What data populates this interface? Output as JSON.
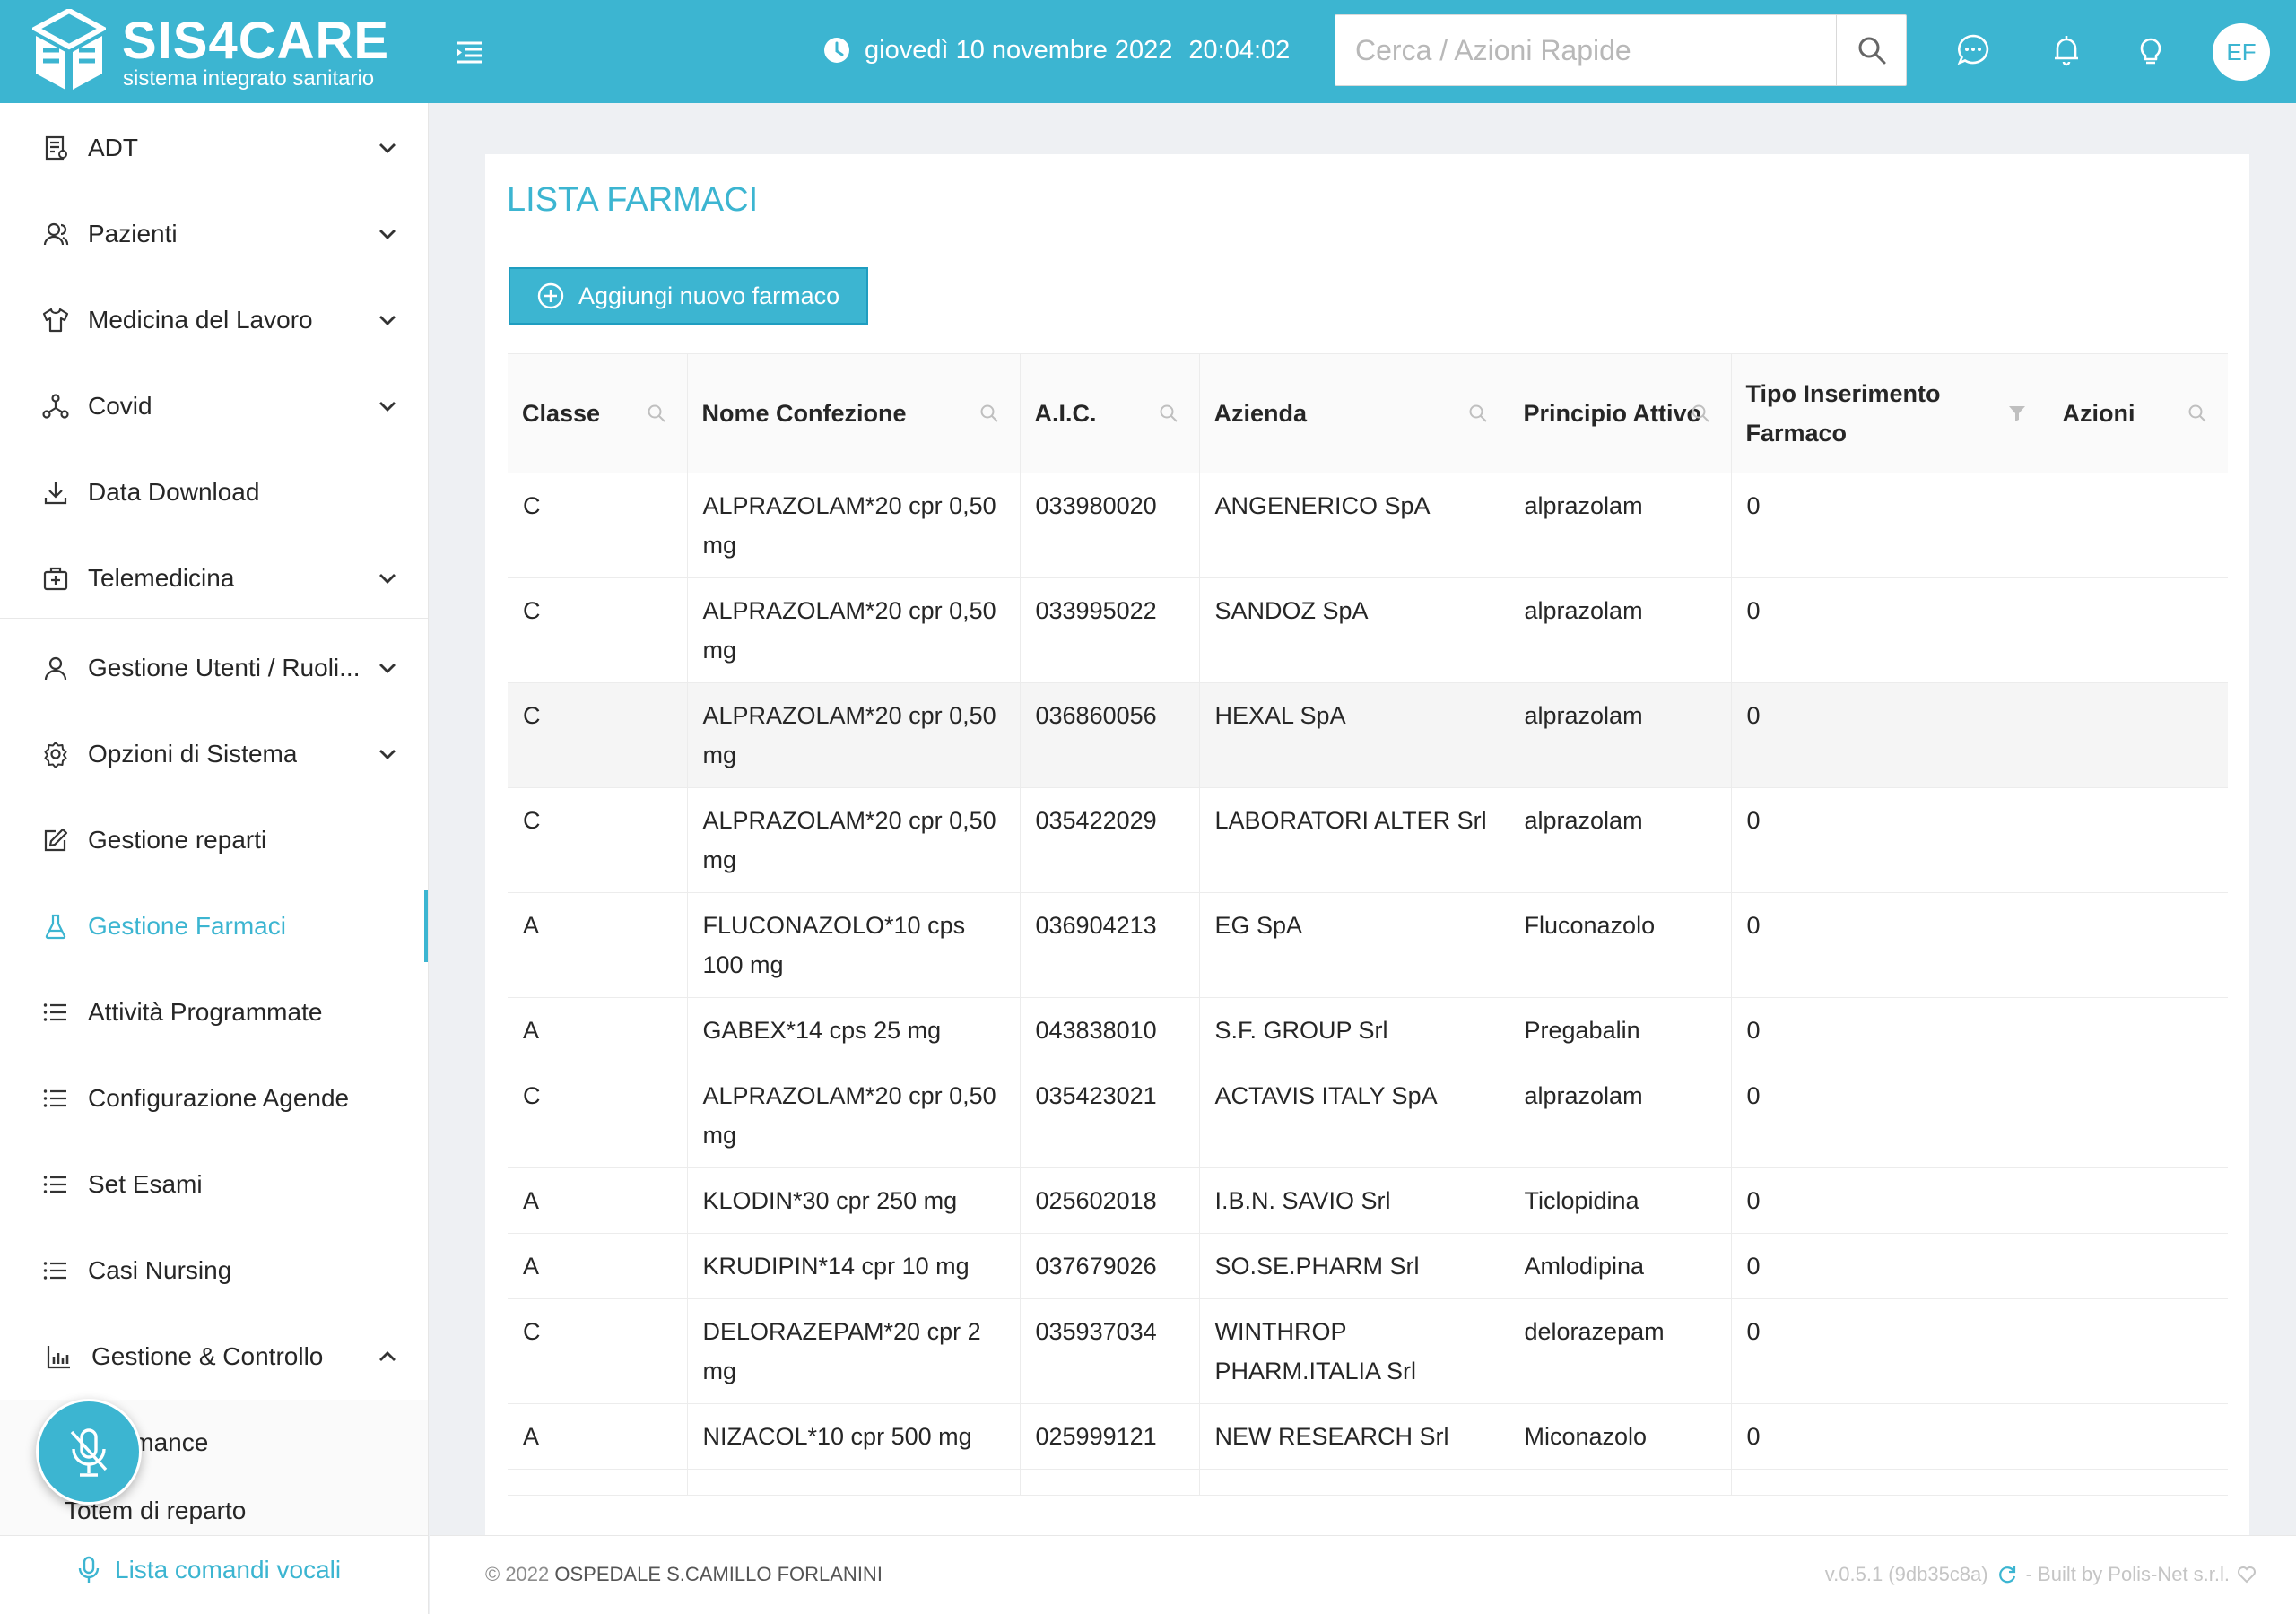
{
  "header": {
    "app_name": "SIS4CARE",
    "app_subtitle": "sistema integrato sanitario",
    "date": "giovedì 10 novembre 2022",
    "time": "20:04:02",
    "search_placeholder": "Cerca / Azioni Rapide",
    "user_initials": "EF",
    "colors": {
      "primary": "#3cb5d1",
      "text": "#ffffff"
    },
    "icons": [
      "menu-fold-icon",
      "clock-icon",
      "search-icon",
      "chat-icon",
      "bell-icon",
      "bulb-icon"
    ]
  },
  "sidebar": {
    "items": [
      {
        "label": "ADT",
        "icon": "adt-icon",
        "expandable": true
      },
      {
        "label": "Pazienti",
        "icon": "patients-icon",
        "expandable": true
      },
      {
        "label": "Medicina del Lavoro",
        "icon": "shirt-icon",
        "expandable": true
      },
      {
        "label": "Covid",
        "icon": "nodes-icon",
        "expandable": true
      },
      {
        "label": "Data Download",
        "icon": "download-icon",
        "expandable": false
      },
      {
        "label": "Telemedicina",
        "icon": "medkit-icon",
        "expandable": true
      },
      {
        "label": "Gestione Utenti / Ruoli...",
        "icon": "user-icon",
        "expandable": true
      },
      {
        "label": "Opzioni di Sistema",
        "icon": "gear-icon",
        "expandable": true
      },
      {
        "label": "Gestione reparti",
        "icon": "edit-icon",
        "expandable": false
      },
      {
        "label": "Gestione Farmaci",
        "icon": "flask-icon",
        "expandable": false,
        "active": true
      },
      {
        "label": "Attività Programmate",
        "icon": "list-icon",
        "expandable": false
      },
      {
        "label": "Configurazione Agende",
        "icon": "list-icon",
        "expandable": false
      },
      {
        "label": "Set Esami",
        "icon": "list-icon",
        "expandable": false
      },
      {
        "label": "Casi Nursing",
        "icon": "list-icon",
        "expandable": false
      },
      {
        "label": "Gestione & Controllo",
        "icon": "bar-chart-icon",
        "expandable": true,
        "expanded": true
      }
    ],
    "subitems": [
      {
        "label": "Performance"
      },
      {
        "label": "Totem di reparto"
      }
    ],
    "voice_commands_label": "Lista comandi vocali"
  },
  "main": {
    "title": "LISTA FARMACI",
    "add_button_label": "Aggiungi nuovo farmaco",
    "table": {
      "columns": [
        {
          "label": "Classe",
          "icon": "search-icon"
        },
        {
          "label": "Nome Confezione",
          "icon": "search-icon"
        },
        {
          "label": "A.I.C.",
          "icon": "search-icon"
        },
        {
          "label": "Azienda",
          "icon": "search-icon"
        },
        {
          "label": "Principio Attivo",
          "icon": "search-icon"
        },
        {
          "label": "Tipo Inserimento Farmaco",
          "icon": "filter-icon"
        },
        {
          "label": "Azioni",
          "icon": "search-icon"
        }
      ],
      "rows": [
        [
          "C",
          "ALPRAZOLAM*20 cpr 0,50 mg",
          "033980020",
          "ANGENERICO SpA",
          "alprazolam",
          "0",
          ""
        ],
        [
          "C",
          "ALPRAZOLAM*20 cpr 0,50 mg",
          "033995022",
          "SANDOZ SpA",
          "alprazolam",
          "0",
          ""
        ],
        [
          "C",
          "ALPRAZOLAM*20 cpr 0,50 mg",
          "036860056",
          "HEXAL SpA",
          "alprazolam",
          "0",
          ""
        ],
        [
          "C",
          "ALPRAZOLAM*20 cpr 0,50 mg",
          "035422029",
          "LABORATORI ALTER Srl",
          "alprazolam",
          "0",
          ""
        ],
        [
          "A",
          "FLUCONAZOLO*10 cps 100 mg",
          "036904213",
          "EG SpA",
          "Fluconazolo",
          "0",
          ""
        ],
        [
          "A",
          "GABEX*14 cps 25 mg",
          "043838010",
          "S.F. GROUP Srl",
          "Pregabalin",
          "0",
          ""
        ],
        [
          "C",
          "ALPRAZOLAM*20 cpr 0,50 mg",
          "035423021",
          "ACTAVIS ITALY SpA",
          "alprazolam",
          "0",
          ""
        ],
        [
          "A",
          "KLODIN*30 cpr 250 mg",
          "025602018",
          "I.B.N. SAVIO Srl",
          "Ticlopidina",
          "0",
          ""
        ],
        [
          "A",
          "KRUDIPIN*14 cpr 10 mg",
          "037679026",
          "SO.SE.PHARM Srl",
          "Amlodipina",
          "0",
          ""
        ],
        [
          "C",
          "DELORAZEPAM*20 cpr 2 mg",
          "035937034",
          "WINTHROP PHARM.ITALIA Srl",
          "delorazepam",
          "0",
          ""
        ],
        [
          "A",
          "NIZACOL*10 cpr 500 mg",
          "025999121",
          "NEW RESEARCH Srl",
          "Miconazolo",
          "0",
          ""
        ],
        [
          "",
          "",
          "",
          "",
          "",
          "",
          ""
        ]
      ],
      "highlighted_row": 2
    }
  },
  "footer": {
    "copyright": "© 2022",
    "organization": "OSPEDALE S.CAMILLO FORLANINI",
    "version": "v.0.5.1 (9db35c8a)",
    "built_by": "- Built by Polis-Net s.r.l."
  }
}
